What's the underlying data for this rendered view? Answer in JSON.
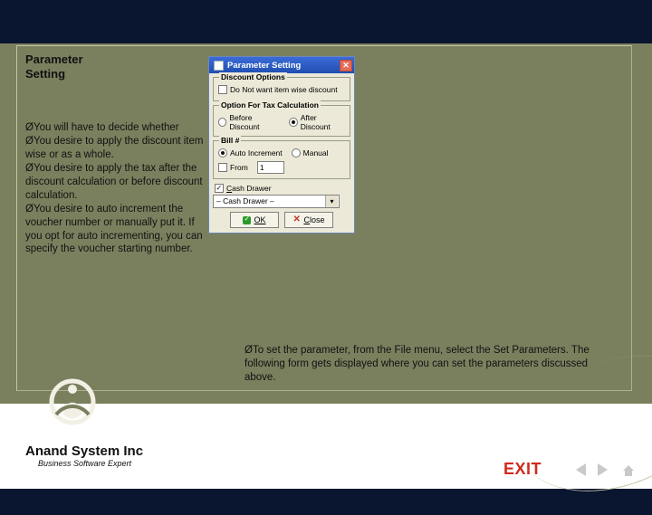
{
  "slide": {
    "title_line1": "Parameter",
    "title_line2": "Setting",
    "bullets": [
      "You will have to decide whether",
      "You desire to apply the discount item wise or as a whole.",
      "You desire to apply the tax after the discount calculation or before discount calculation.",
      "You desire to auto increment the voucher number or manually put it. If you opt for auto incrementing, you can specify the voucher starting number."
    ],
    "right_bullet": "To set the parameter, from the File menu, select the Set Parameters. The following form gets displayed where you can set the parameters discussed above.",
    "bullet_glyph": "Ø"
  },
  "dialog": {
    "title": "Parameter Setting",
    "group_discount": "Discount Options",
    "chk_itemwise": "Do Not want item wise discount",
    "group_tax": "Option For Tax Calculation",
    "rd_before": "Before Discount",
    "rd_after": "After Discount",
    "group_bill": "Bill #",
    "rd_autoinc": "Auto Increment",
    "rd_manual": "Manual",
    "chk_from": "From",
    "from_value": "1",
    "chk_cash": "Cash Drawer",
    "cash_value": "– Cash Drawer –",
    "btn_ok": "OK",
    "btn_close": "Close"
  },
  "footer": {
    "company": "Anand System Inc",
    "tagline": "Business Software Expert",
    "exit": "EXIT"
  }
}
